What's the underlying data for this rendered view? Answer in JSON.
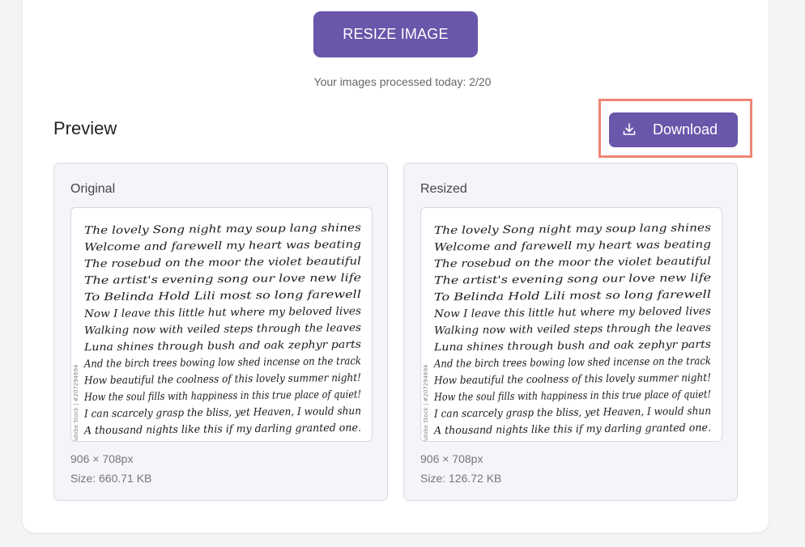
{
  "resize_button": {
    "label": "RESIZE IMAGE"
  },
  "quota_text": "Your images processed today: 2/20",
  "preview": {
    "title": "Preview",
    "download_label": "Download",
    "original": {
      "title": "Original",
      "dimensions": "906 × 708px",
      "size": "Size: 660.71 KB"
    },
    "resized": {
      "title": "Resized",
      "dimensions": "906 × 708px",
      "size": "Size: 126.72 KB"
    }
  },
  "handwriting_lines": [
    "The lovely Song night may soup lang shines",
    "Welcome and farewell my heart was beating",
    "The rosebud on the moor the violet beautiful",
    "The artist's evening song our love new life",
    "To Belinda Hold Lili most so long farewell",
    "Now I leave this little hut where my beloved lives",
    "Walking now with veiled steps through the leaves",
    "Luna shines through bush and oak zephyr parts",
    "And the birch trees bowing low shed incense on the track",
    "How beautiful the coolness of this lovely summer night!",
    "How the soul fills with happiness in this true place of quiet!",
    "I can scarcely grasp the bliss, yet Heaven, I would shun",
    "A thousand nights like this if my darling granted one."
  ],
  "watermark": "Adobe Stock | #207294694",
  "colors": {
    "accent": "#6a56aa",
    "highlight": "#ee8574"
  }
}
